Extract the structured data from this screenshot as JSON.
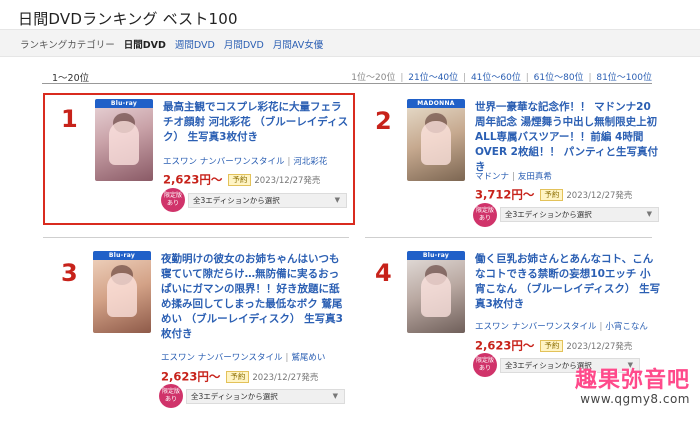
{
  "page_title": "日間DVDランキング ベスト100",
  "category_bar": {
    "label": "ランキングカテゴリー",
    "current": "日間DVD",
    "links": [
      "週間DVD",
      "月間DVD",
      "月間AV女優"
    ]
  },
  "range": {
    "current": "1〜20位",
    "pager": [
      "1位〜20位",
      "21位〜40位",
      "41位〜60位",
      "61位〜80位",
      "81位〜100位"
    ]
  },
  "items": [
    {
      "rank": "1",
      "title": "最高主観でコスプレ彩花に大量フェラチオ顔射 河北彩花 （ブルーレイディスク） 生写真3枚付き",
      "maker": "エスワン ナンバーワンスタイル",
      "performer": "河北彩花",
      "price": "2,623円〜",
      "reserve": "予約",
      "release": "2023/12/27発売",
      "badge": [
        "限定版",
        "あり"
      ],
      "edition": "全3エディションから選択"
    },
    {
      "rank": "2",
      "title": "世界一豪華な記念作！！ マドンナ20周年記念 湯煙舞う中出し無制限史上初ALL専属バスツアー！！前編 4時間OVER 2枚組！！ パンティと生写真付き",
      "maker": "マドンナ",
      "performer": "友田真希",
      "price": "3,712円〜",
      "reserve": "予約",
      "release": "2023/12/27発売",
      "badge": [
        "限定版",
        "あり"
      ],
      "edition": "全3エディションから選択"
    },
    {
      "rank": "3",
      "title": "夜勤明けの彼女のお姉ちゃんはいつも寝ていて隙だらけ…無防備に実るおっぱいにガマンの限界！！好き放題に舐め揉み回してしまった最低なボク 鷲尾めい （ブルーレイディスク） 生写真3枚付き",
      "maker": "エスワン ナンバーワンスタイル",
      "performer": "鷲尾めい",
      "price": "2,623円〜",
      "reserve": "予約",
      "release": "2023/12/27発売",
      "badge": [
        "限定版",
        "あり"
      ],
      "edition": "全3エディションから選択"
    },
    {
      "rank": "4",
      "title": "働く巨乳お姉さんとあんなコト、こんなコトできる禁断の妄想10エッチ 小宵こなん （ブルーレイディスク） 生写真3枚付き",
      "maker": "エスワン ナンバーワンスタイル",
      "performer": "小宵こなん",
      "price": "2,623円〜",
      "reserve": "予約",
      "release": "2023/12/27発売",
      "badge": [
        "限定版",
        "あり"
      ],
      "edition": "全3エディションから選択"
    }
  ],
  "watermark": {
    "main": "趣果弥音吧",
    "url": "www.qgmy8.com"
  },
  "colors": {
    "rank_red": "#c7221a",
    "link_blue": "#2b5fb3",
    "highlight_border": "#d92b1f",
    "badge_pink": "#d0336a"
  }
}
